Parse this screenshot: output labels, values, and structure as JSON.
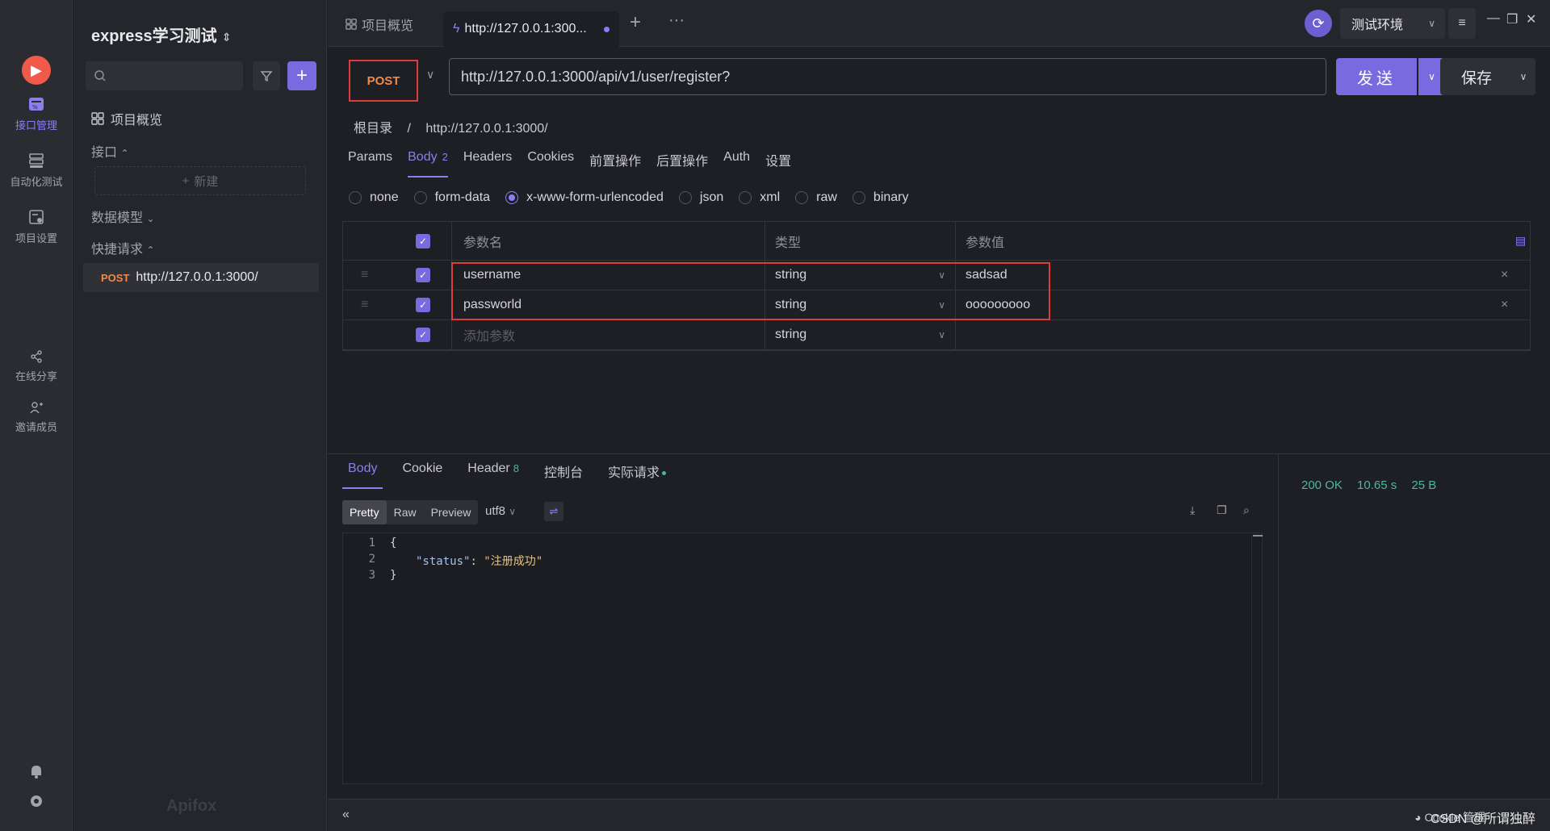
{
  "rail": {
    "items": [
      {
        "label": "接口管理",
        "icon": "api-management-icon"
      },
      {
        "label": "自动化测试",
        "icon": "automation-test-icon"
      },
      {
        "label": "项目设置",
        "icon": "project-settings-icon"
      },
      {
        "label": "在线分享",
        "icon": "share-icon"
      },
      {
        "label": "邀请成员",
        "icon": "invite-member-icon"
      }
    ],
    "bottom_icons": [
      "bell-icon",
      "gear-icon"
    ]
  },
  "sidebar": {
    "project_title": "express学习测试",
    "search_placeholder": "",
    "overview_label": "项目概览",
    "api_group": "接口",
    "new_label": "新建",
    "data_model": "数据模型",
    "quick_request": "快捷请求",
    "quick_item": {
      "method": "POST",
      "url": "http://127.0.0.1:3000/"
    },
    "watermark": "Apifox"
  },
  "topbar": {
    "tab_overview": "项目概览",
    "tab_request": "http://127.0.0.1:300...",
    "environment": "测试环境"
  },
  "request": {
    "method": "POST",
    "url": "http://127.0.0.1:3000/api/v1/user/register?",
    "send_label": "发送",
    "save_label": "保存",
    "breadcrumb": [
      "根目录",
      "/",
      "http://127.0.0.1:3000/"
    ],
    "tabs": [
      "Params",
      "Body",
      "Headers",
      "Cookies",
      "前置操作",
      "后置操作",
      "Auth",
      "设置"
    ],
    "body_count": "2",
    "active_tab": "Body",
    "body_types": [
      "none",
      "form-data",
      "x-www-form-urlencoded",
      "json",
      "xml",
      "raw",
      "binary"
    ],
    "selected_body_type": "x-www-form-urlencoded",
    "table": {
      "headers": [
        "参数名",
        "类型",
        "参数值"
      ],
      "rows": [
        {
          "name": "username",
          "type": "string",
          "value": "sadsad"
        },
        {
          "name": "passworld",
          "type": "string",
          "value": "ooooooooo"
        }
      ],
      "new_row": {
        "placeholder": "添加参数",
        "type": "string"
      }
    }
  },
  "response": {
    "tabs": [
      "Body",
      "Cookie",
      "Header",
      "控制台",
      "实际请求"
    ],
    "header_count": "8",
    "active_tab": "Body",
    "formats": [
      "Pretty",
      "Raw",
      "Preview"
    ],
    "active_format": "Pretty",
    "encoding": "utf8",
    "status": "200 OK",
    "time": "10.65 s",
    "size": "25 B",
    "code_lines": [
      {
        "n": "1",
        "text": "{"
      },
      {
        "n": "2",
        "key": "\"status\"",
        "sep": ": ",
        "val": "\"注册成功\""
      },
      {
        "n": "3",
        "text": "}"
      }
    ]
  },
  "footer": {
    "cookie_label": "Cookie 管理",
    "watermark": "CSDN @所谓独醉"
  },
  "colors": {
    "accent": "#7a6ae0",
    "method_post": "#f08a4b",
    "success": "#4cb89a",
    "highlight_box": "#e03c3c"
  }
}
